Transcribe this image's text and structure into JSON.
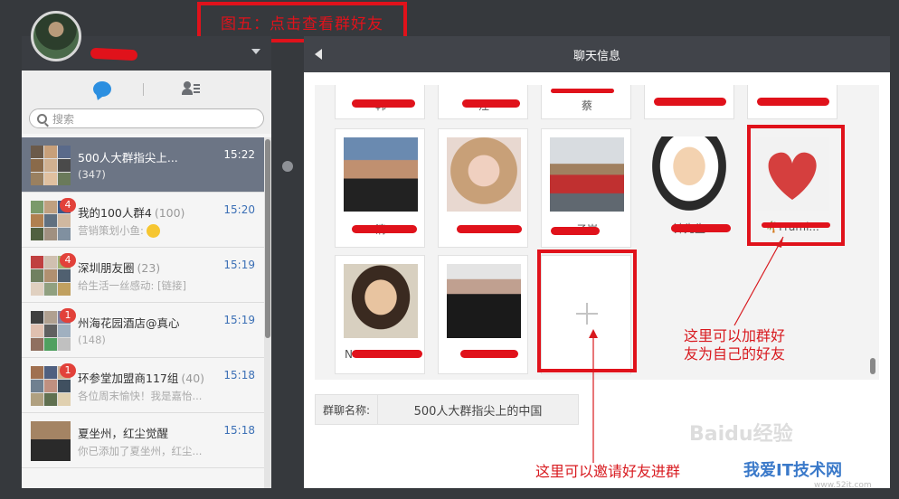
{
  "caption": "图五：点击查看群好友",
  "left_panel": {
    "search_placeholder": "搜索",
    "conversations": [
      {
        "name": "500人大群指尖上...",
        "count": "(347)",
        "time": "15:22",
        "message": "",
        "badge": "",
        "active": true
      },
      {
        "name": "我的100人群4",
        "count": "(100)",
        "time": "15:20",
        "message": "营销策划小鱼:",
        "badge": "4",
        "active": false
      },
      {
        "name": "深圳朋友圈",
        "count": "(23)",
        "time": "15:19",
        "message": "给生活一丝感动: [链接]",
        "badge": "4",
        "active": false
      },
      {
        "name": "州海花园酒店@真心",
        "count": "(148)",
        "time": "15:19",
        "message": "",
        "badge": "1",
        "active": false
      },
      {
        "name": "环参堂加盟商117组",
        "count": "(40)",
        "time": "15:18",
        "message": "各位周末愉快！我是嘉怡...",
        "badge": "1",
        "active": false
      },
      {
        "name": "夏坐州，红尘觉醒",
        "count": "",
        "time": "15:18",
        "message": "你已添加了夏坐州，红尘...",
        "badge": "",
        "active": false
      }
    ]
  },
  "right_panel": {
    "title": "聊天信息",
    "top_row_names": [
      "韩",
      "汪",
      "蔡",
      "",
      ""
    ],
    "members_row1": [
      {
        "name": "清"
      },
      {
        "name": ""
      },
      {
        "name": "子岸"
      },
      {
        "name": "钟先生"
      },
      {
        "name": "Frami..."
      }
    ],
    "members_row2": [
      {
        "name": "N"
      },
      {
        "name": ""
      }
    ],
    "group_name_label": "群聊名称:",
    "group_name_value": "500人大群指尖上的中国"
  },
  "annotations": {
    "add_friend_text_line1": "这里可以加群好",
    "add_friend_text_line2": "友为自己的好友",
    "invite_text": "这里可以邀请好友进群"
  },
  "watermark": {
    "brand": "Baidu经验",
    "site": "我爱IT技术网",
    "url": "www.52it.com"
  },
  "colors": {
    "annotation_red": "#e0121b",
    "header_dark": "#41444a",
    "active_row": "#6c7585",
    "chat_icon_blue": "#2c8fe0"
  }
}
